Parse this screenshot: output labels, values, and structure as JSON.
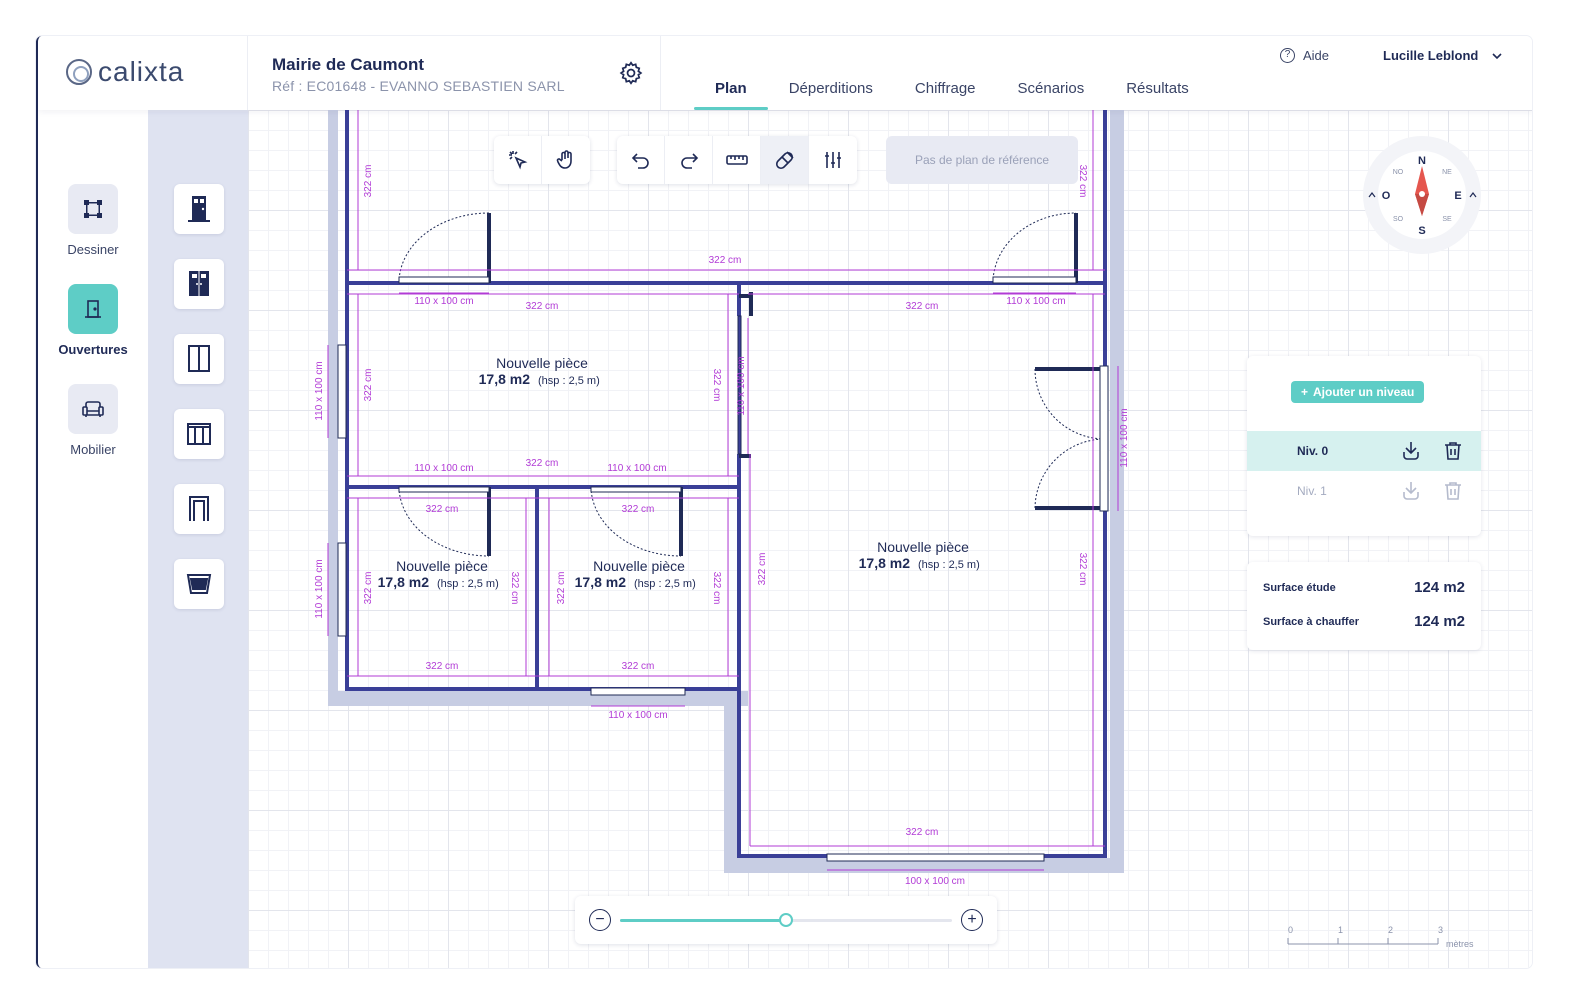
{
  "app": {
    "logo_text": "calixta"
  },
  "project": {
    "name": "Mairie de Caumont",
    "ref": "Réf : EC01648 - EVANNO SEBASTIEN SARL"
  },
  "tabs": [
    {
      "label": "Plan",
      "active": true
    },
    {
      "label": "Déperditions"
    },
    {
      "label": "Chiffrage"
    },
    {
      "label": "Scénarios"
    },
    {
      "label": "Résultats"
    }
  ],
  "header": {
    "help_label": "Aide",
    "user_name": "Lucille Leblond"
  },
  "left_rail": [
    {
      "label": "Dessiner",
      "icon": "draw-shape-icon"
    },
    {
      "label": "Ouvertures",
      "icon": "door-icon",
      "active": true
    },
    {
      "label": "Mobilier",
      "icon": "sofa-icon"
    }
  ],
  "openings": [
    {
      "icon": "single-door-icon"
    },
    {
      "icon": "double-door-icon"
    },
    {
      "icon": "window-icon"
    },
    {
      "icon": "double-window-icon"
    },
    {
      "icon": "opening-frame-icon"
    },
    {
      "icon": "roof-window-icon"
    }
  ],
  "toolbar": {
    "tools": [
      "select-icon",
      "pan-hand-icon",
      "undo-icon",
      "redo-icon",
      "ruler-icon",
      "magnet-icon",
      "settings-sliders-icon"
    ],
    "reference_plan": "Pas de plan de référence"
  },
  "compass": {
    "n": "N",
    "s": "S",
    "e": "E",
    "o": "O",
    "ne": "NE",
    "no": "NO",
    "se": "SE",
    "so": "SO"
  },
  "levels": {
    "add_label": "Ajouter un niveau",
    "items": [
      {
        "name": "Niv. 0",
        "active": true
      },
      {
        "name": "Niv. 1",
        "active": false
      }
    ]
  },
  "surfaces": {
    "etude_label": "Surface étude",
    "etude_value": "124 m2",
    "chauffer_label": "Surface à chauffer",
    "chauffer_value": "124 m2"
  },
  "zoom": {
    "level": 0.5
  },
  "scale_bar": {
    "ticks": [
      "0",
      "1",
      "2",
      "3"
    ],
    "unit": "mètres"
  },
  "plan": {
    "rooms": [
      {
        "name": "Nouvelle pièce",
        "area": "17,8 m2",
        "hsp": "(hsp : 2,5 m)"
      },
      {
        "name": "Nouvelle pièce",
        "area": "17,8 m2",
        "hsp": "(hsp : 2,5 m)"
      },
      {
        "name": "Nouvelle pièce",
        "area": "17,8 m2",
        "hsp": "(hsp : 2,5 m)"
      },
      {
        "name": "Nouvelle pièce",
        "area": "17,8 m2",
        "hsp": "(hsp : 2,5 m)"
      }
    ],
    "dim_322": "322 cm",
    "dim_110": "110 x 100 cm",
    "dim_100": "100 x 100 cm"
  }
}
